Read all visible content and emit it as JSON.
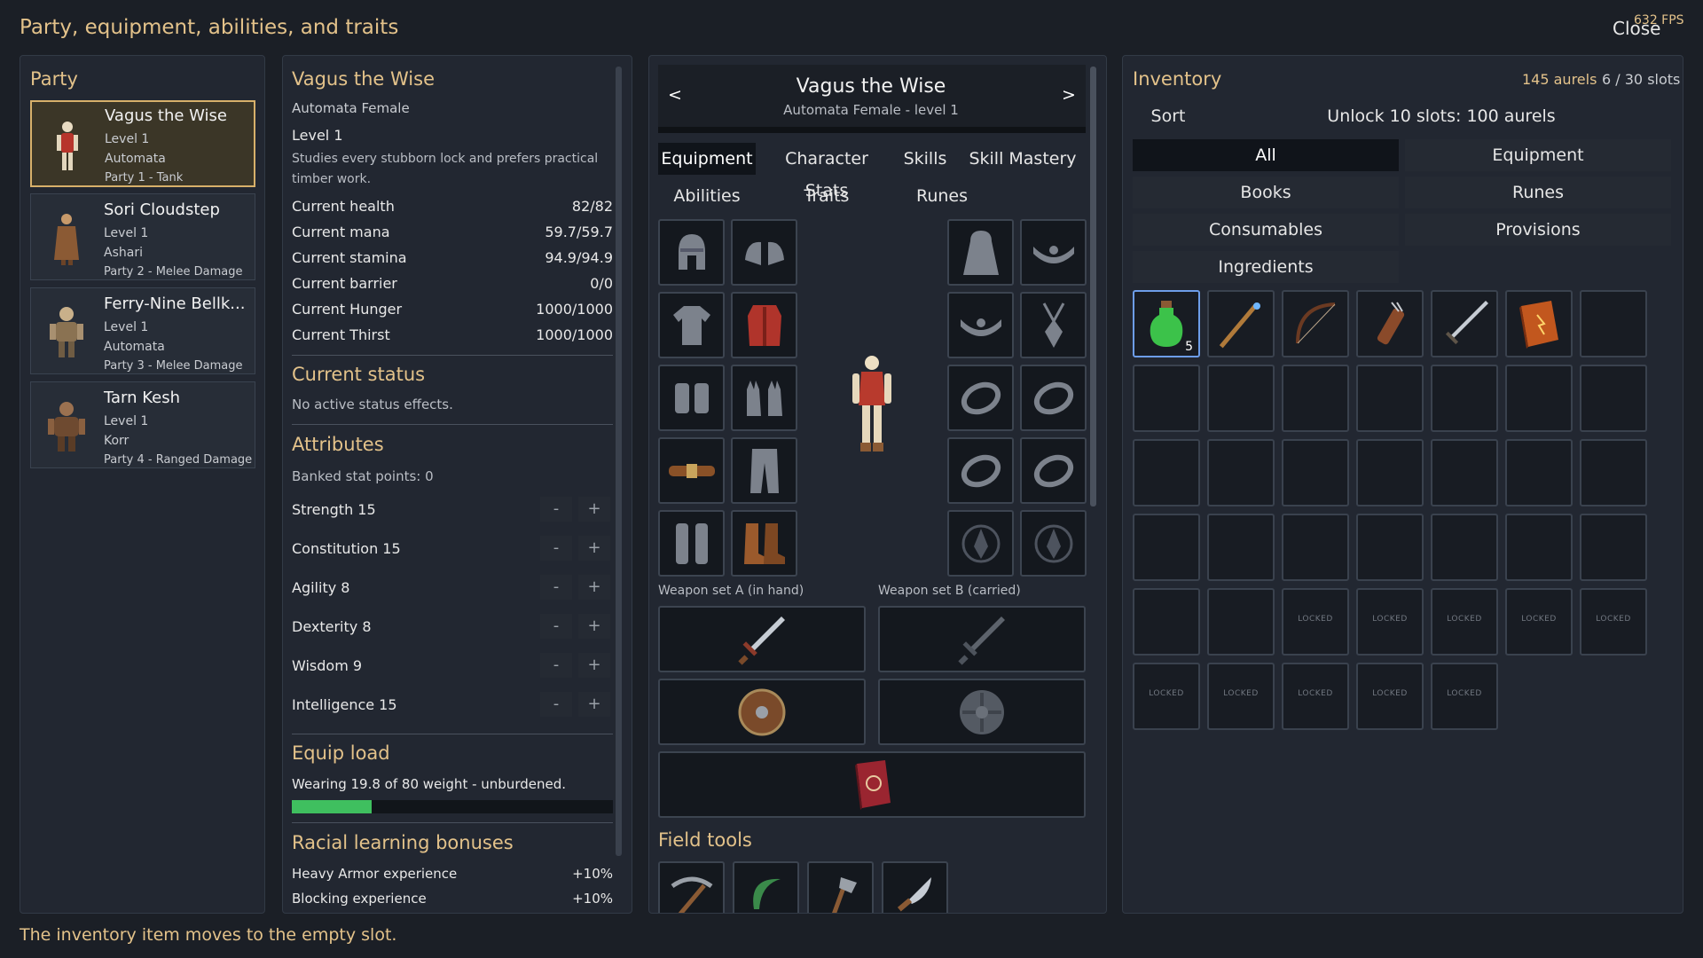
{
  "header": {
    "title": "Party, equipment, abilities, and traits",
    "fps": "632 FPS",
    "close_label": "Close"
  },
  "status_line": "The inventory item moves to the empty slot.",
  "party": {
    "title": "Party",
    "members": [
      {
        "name": "Vagus the Wise",
        "level": "Level 1",
        "race": "Automata",
        "role": "Party 1 - Tank",
        "selected": true
      },
      {
        "name": "Sori Cloudstep",
        "level": "Level 1",
        "race": "Ashari",
        "role": "Party 2 - Melee Damage"
      },
      {
        "name": "Ferry-Nine Bellk...",
        "level": "Level 1",
        "race": "Automata",
        "role": "Party 3 - Melee Damage"
      },
      {
        "name": "Tarn Kesh",
        "level": "Level 1",
        "race": "Korr",
        "role": "Party 4 - Ranged Damage"
      }
    ]
  },
  "details": {
    "name": "Vagus the Wise",
    "subtitle": "Automata Female",
    "level": "Level 1",
    "bio_line1": "Studies every stubborn lock and prefers practical",
    "bio_line2": "timber work.",
    "stats": [
      {
        "label": "Current health",
        "value": "82/82"
      },
      {
        "label": "Current mana",
        "value": "59.7/59.7"
      },
      {
        "label": "Current stamina",
        "value": "94.9/94.9"
      },
      {
        "label": "Current barrier",
        "value": "0/0"
      },
      {
        "label": "Current Hunger",
        "value": "1000/1000"
      },
      {
        "label": "Current Thirst",
        "value": "1000/1000"
      }
    ],
    "status_title": "Current status",
    "status_text": "No active status effects.",
    "attributes_title": "Attributes",
    "banked": "Banked stat points: 0",
    "attributes": [
      {
        "label": "Strength  15"
      },
      {
        "label": "Constitution  15"
      },
      {
        "label": "Agility  8"
      },
      {
        "label": "Dexterity  8"
      },
      {
        "label": "Wisdom  9"
      },
      {
        "label": "Intelligence  15"
      }
    ],
    "minus": "-",
    "plus": "+",
    "equip_load_title": "Equip load",
    "equip_load_text": "Wearing 19.8 of 80 weight - unburdened.",
    "equip_load_fraction": 0.2475,
    "racial_title": "Racial learning bonuses",
    "racial": [
      {
        "label": "Heavy Armor experience",
        "value": "+10%"
      },
      {
        "label": "Blocking experience",
        "value": "+10%"
      }
    ]
  },
  "equipment": {
    "prev": "<",
    "next": ">",
    "name": "Vagus the Wise",
    "subtitle": "Automata Female - level 1",
    "tabs_row1": [
      "Equipment",
      "Character Stats",
      "Skills",
      "Skill Mastery"
    ],
    "tabs_row2": [
      "Abilities",
      "Traits",
      "Runes"
    ],
    "weapon_set_a": "Weapon set A (in hand)",
    "weapon_set_b": "Weapon set B (carried)",
    "field_tools": "Field tools"
  },
  "inventory": {
    "title": "Inventory",
    "currency": "145 aurels",
    "slots": "6 / 30 slots",
    "sort": "Sort",
    "unlock": "Unlock 10 slots: 100 aurels",
    "filters": [
      "All",
      "Equipment",
      "Books",
      "Runes",
      "Consumables",
      "Provisions",
      "Ingredients"
    ],
    "potion_count": "5",
    "locked_label": "LOCKED"
  },
  "colors": {
    "accent": "#e3c28a",
    "selected_border": "#d7b06a",
    "load_bar": "#3fbf5f",
    "inv_select": "#6d9de8"
  }
}
